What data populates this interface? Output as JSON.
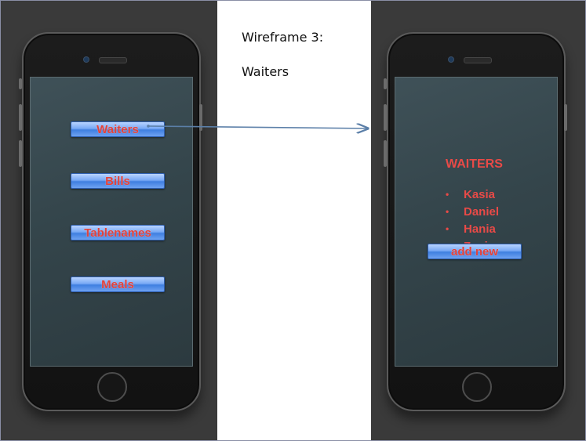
{
  "slide": {
    "title": "Wireframe 3:",
    "subtitle": "Waiters"
  },
  "left_phone": {
    "menu_buttons": [
      {
        "label": "Waiters"
      },
      {
        "label": "Bills"
      },
      {
        "label": "Tablenames"
      },
      {
        "label": "Meals"
      }
    ]
  },
  "right_phone": {
    "heading": "WAITERS",
    "bullet_glyph": "•",
    "waiters": [
      "Kasia",
      "Daniel",
      "Hania",
      "Zosia"
    ],
    "add_button_label": "add new"
  },
  "colors": {
    "label_red": "#e84a47",
    "button_blue": "#5b92ec",
    "screen": "#3a4b51",
    "arrow": "#5b7fa8"
  }
}
